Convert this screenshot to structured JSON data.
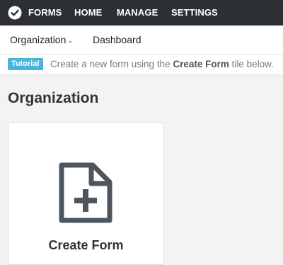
{
  "nav": {
    "brand": "FORMS",
    "items": [
      {
        "label": "HOME"
      },
      {
        "label": "MANAGE"
      },
      {
        "label": "SETTINGS"
      }
    ]
  },
  "subnav": {
    "organization": "Organization",
    "dashboard": "Dashboard"
  },
  "tutorial": {
    "badge": "Tutorial",
    "text_before": "Create a new form using the ",
    "text_bold": "Create Form",
    "text_after": " tile below."
  },
  "page": {
    "title": "Organization"
  },
  "tiles": [
    {
      "label": "Create Form",
      "icon": "file-plus-icon"
    }
  ],
  "colors": {
    "topbar": "#2c2f33",
    "badge": "#4ab3d9"
  }
}
